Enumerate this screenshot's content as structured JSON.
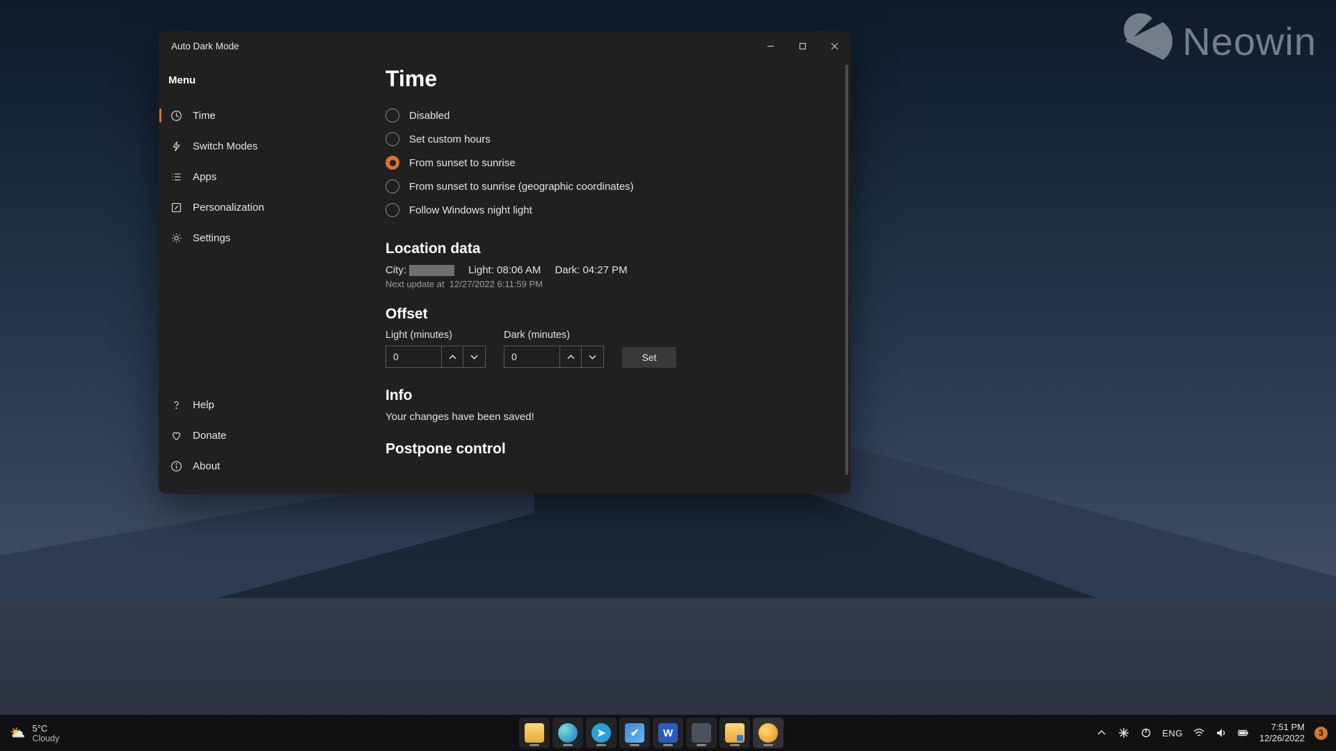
{
  "watermark": "Neowin",
  "window": {
    "title": "Auto Dark Mode"
  },
  "sidebar": {
    "header": "Menu",
    "items": [
      {
        "label": "Time",
        "icon": "clock-icon",
        "active": true
      },
      {
        "label": "Switch Modes",
        "icon": "bolt-icon"
      },
      {
        "label": "Apps",
        "icon": "list-icon"
      },
      {
        "label": "Personalization",
        "icon": "edit-icon"
      },
      {
        "label": "Settings",
        "icon": "gear-icon"
      }
    ],
    "footer": [
      {
        "label": "Help",
        "icon": "help-icon"
      },
      {
        "label": "Donate",
        "icon": "heart-icon"
      },
      {
        "label": "About",
        "icon": "info-icon"
      }
    ]
  },
  "page": {
    "title": "Time",
    "radios": [
      "Disabled",
      "Set custom hours",
      "From sunset to sunrise",
      "From sunset to sunrise (geographic coordinates)",
      "Follow Windows night light"
    ],
    "radio_selected_index": 2,
    "location": {
      "heading": "Location data",
      "city_label": "City:",
      "light_label": "Light:",
      "light_time": "08:06 AM",
      "dark_label": "Dark:",
      "dark_time": "04:27 PM",
      "next_update_label": "Next update at",
      "next_update_value": "12/27/2022 6:11:59 PM"
    },
    "offset": {
      "heading": "Offset",
      "light_label": "Light (minutes)",
      "light_value": "0",
      "dark_label": "Dark (minutes)",
      "dark_value": "0",
      "set_button": "Set"
    },
    "info": {
      "heading": "Info",
      "message": "Your changes have been saved!"
    },
    "postpone": {
      "heading": "Postpone control"
    }
  },
  "taskbar": {
    "weather_temp": "5°C",
    "weather_desc": "Cloudy",
    "lang": "ENG",
    "time": "7:51 PM",
    "date": "12/26/2022",
    "notif_count": "3"
  }
}
